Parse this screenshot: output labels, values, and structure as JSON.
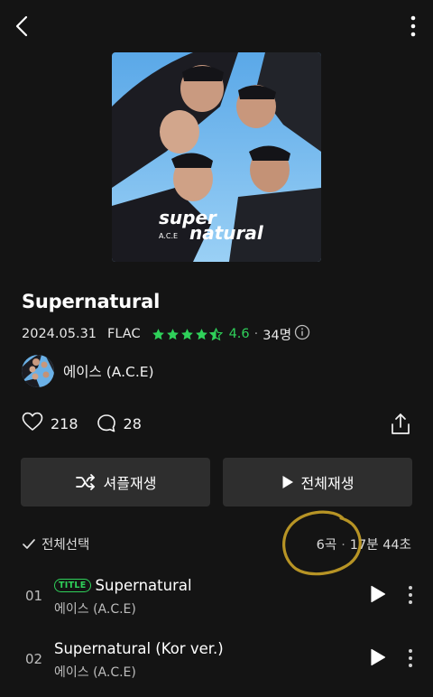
{
  "album": {
    "title": "Supernatural",
    "release_date": "2024.05.31",
    "format": "FLAC",
    "rating_value": "4.6",
    "rating_stars": 4.6,
    "rating_count": "34명",
    "cover_text_line1": "super",
    "cover_text_line2": "natural",
    "cover_artist_text": "A.C.E"
  },
  "artist": {
    "name": "에이스 (A.C.E)"
  },
  "social": {
    "likes": "218",
    "comments": "28"
  },
  "buttons": {
    "shuffle_label": "셔플재생",
    "play_all_label": "전체재생"
  },
  "list_header": {
    "select_all_label": "전체선택",
    "track_count": "6곡",
    "separator": "·",
    "total_duration": "17분 44초"
  },
  "tracks": [
    {
      "number": "01",
      "badge": "TITLE",
      "title": "Supernatural",
      "artist": "에이스 (A.C.E)"
    },
    {
      "number": "02",
      "badge": "",
      "title": "Supernatural (Kor ver.)",
      "artist": "에이스 (A.C.E)"
    }
  ],
  "colors": {
    "background": "#141414",
    "accent_green": "#2fd15a",
    "button_bg": "#2e2e2e",
    "annotation": "#c9a227"
  },
  "icons": [
    "back-icon",
    "more-vertical-icon",
    "star-icon",
    "info-icon",
    "heart-icon",
    "comment-icon",
    "share-icon",
    "shuffle-icon",
    "play-icon",
    "check-icon"
  ]
}
